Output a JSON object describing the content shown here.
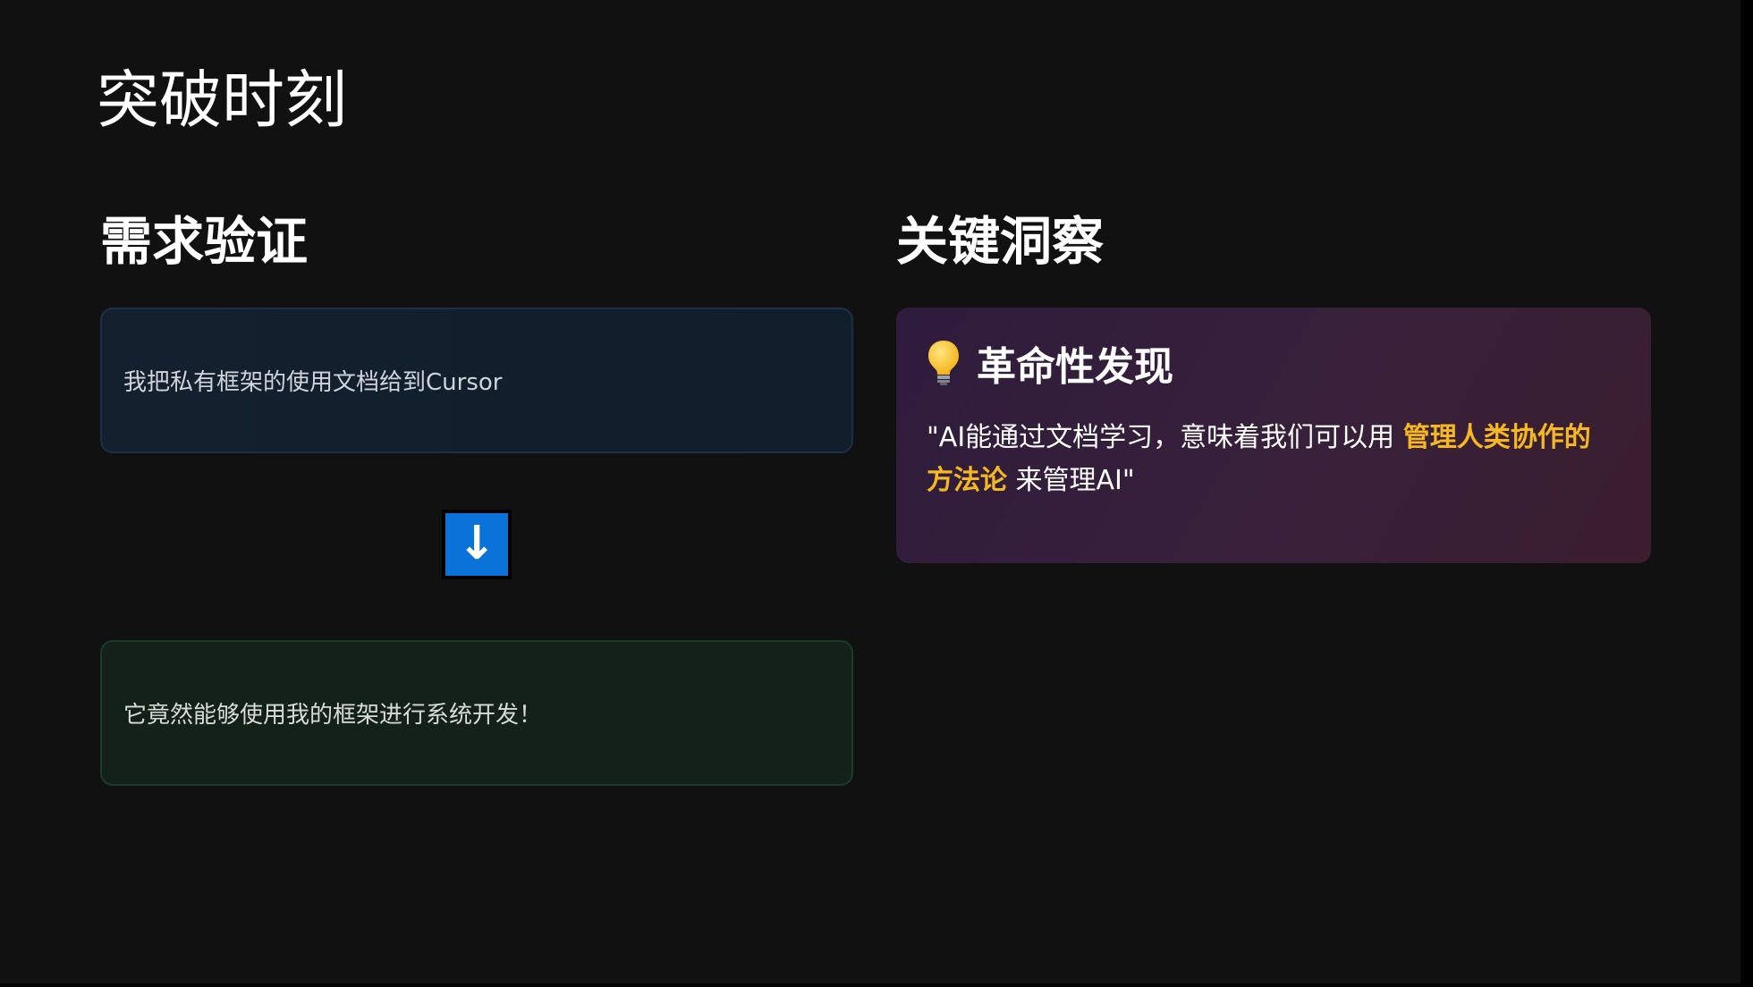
{
  "page": {
    "title": "突破时刻"
  },
  "left": {
    "heading": "需求验证",
    "step_text": "我把私有框架的使用文档给到Cursor",
    "arrow_glyph": "↓",
    "result_text": "它竟然能够使用我的框架进行系统开发！"
  },
  "right": {
    "heading": "关键洞察",
    "card_icon": "lightbulb-icon",
    "card_title": "革命性发现",
    "quote_before": "\"AI能通过文档学习，意味着我们可以用 ",
    "quote_highlight": "管理人类协作的方法论",
    "quote_after": " 来管理AI\""
  },
  "colors": {
    "background": "#111111",
    "accent_blue": "#0a72d8",
    "highlight_gold": "#f5b820"
  }
}
